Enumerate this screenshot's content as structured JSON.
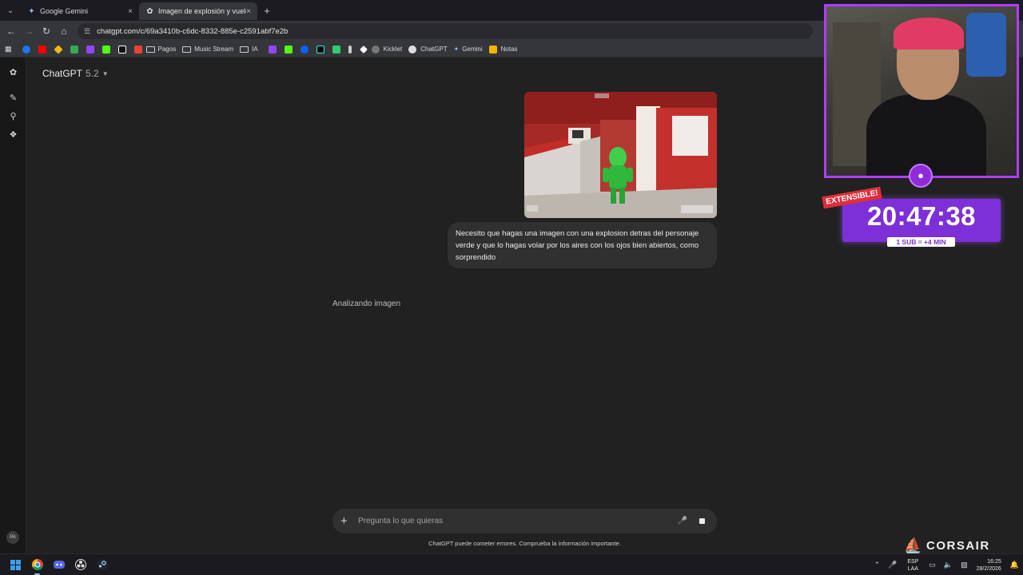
{
  "browser": {
    "tabs": [
      {
        "title": "Google Gemini",
        "icon": "gemini-icon",
        "active": false
      },
      {
        "title": "Imagen de explosión y vuelo",
        "icon": "chatgpt-icon",
        "active": true
      }
    ],
    "url": "chatgpt.com/c/69a3410b-c6dc-8332-885e-c2591abf7e2b",
    "bookmarks": [
      {
        "label": "Pagos",
        "type": "folder"
      },
      {
        "label": "Music Stream",
        "type": "folder"
      },
      {
        "label": "IA",
        "type": "folder"
      },
      {
        "label": "Kicklet",
        "type": "link"
      },
      {
        "label": "ChatGPT",
        "type": "link"
      },
      {
        "label": "Gemini",
        "type": "link"
      },
      {
        "label": "Notas",
        "type": "link"
      }
    ]
  },
  "chat": {
    "model_name": "ChatGPT",
    "model_version": "5.2",
    "user_message": "Necesito que hagas una imagen con una explosion detras del personaje verde y que lo hagas volar por los aires con los ojos bien abiertos, como sorprendido",
    "status": "Analizando imagen",
    "composer_placeholder": "Pregunta lo que quieras",
    "disclaimer": "ChatGPT puede cometer errores. Comprueba la información importante.",
    "avatar_initials": "PA"
  },
  "overlay": {
    "timer": "20:47:38",
    "extensible_label": "EXTENSIBLE!",
    "sub_label": "1 SUB = +4 MIN",
    "sponsor": "CORSAIR"
  },
  "taskbar": {
    "lang_line1": "ESP",
    "lang_line2": "LAA",
    "time": "16:25",
    "date": "28/2/2026"
  },
  "colors": {
    "accent_purple": "#7d2fd8",
    "webcam_border": "#b13cff",
    "timer_red_label": "#e22d3a"
  }
}
